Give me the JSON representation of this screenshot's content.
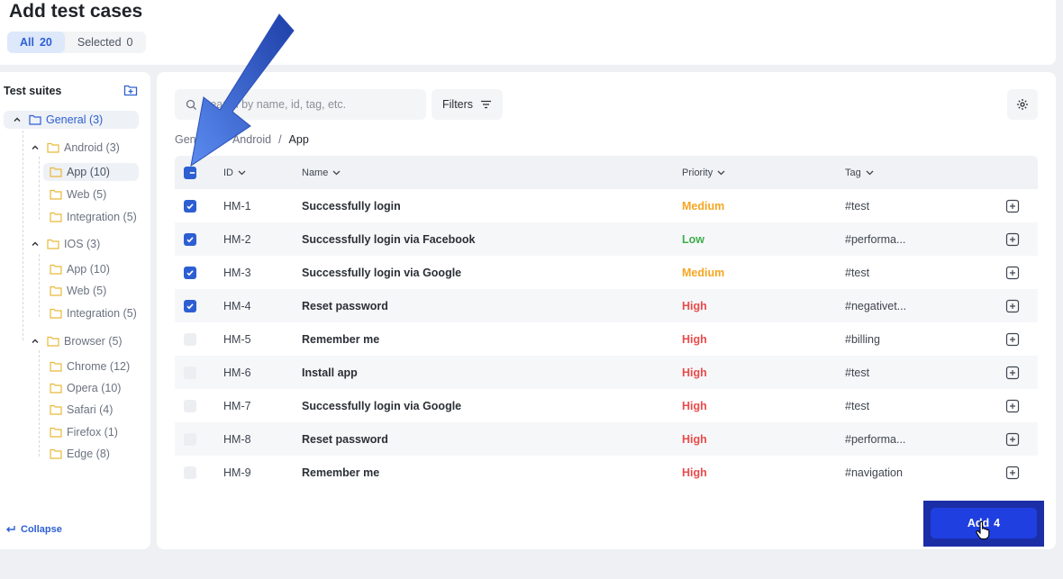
{
  "header": {
    "title": "Add test cases",
    "tabs": [
      {
        "label": "All",
        "count": "20"
      },
      {
        "label": "Selected",
        "count": "0"
      }
    ]
  },
  "sidebar": {
    "title": "Test suites",
    "collapse_label": "Collapse",
    "tree": [
      {
        "label": "General (3)"
      },
      {
        "label": "Android (3)"
      },
      {
        "label": "App (10)"
      },
      {
        "label": "Web (5)"
      },
      {
        "label": "Integration (5)"
      },
      {
        "label": "IOS (3)"
      },
      {
        "label": "App (10)"
      },
      {
        "label": "Web (5)"
      },
      {
        "label": "Integration (5)"
      },
      {
        "label": "Browser (5)"
      },
      {
        "label": "Chrome (12)"
      },
      {
        "label": "Opera (10)"
      },
      {
        "label": "Safari (4)"
      },
      {
        "label": "Firefox (1)"
      },
      {
        "label": "Edge (8)"
      }
    ]
  },
  "toolbar": {
    "search_placeholder": "Search by name, id, tag, etc.",
    "filters_label": "Filters"
  },
  "breadcrumb": [
    "General",
    "Android",
    "App"
  ],
  "table": {
    "columns": {
      "id": "ID",
      "name": "Name",
      "priority": "Priority",
      "tag": "Tag"
    },
    "rows": [
      {
        "id": "HM-1",
        "name": "Successfully login",
        "priority": "Medium",
        "tag": "#test",
        "checked": true
      },
      {
        "id": "HM-2",
        "name": "Successfully login via Facebook",
        "priority": "Low",
        "tag": "#performa...",
        "checked": true
      },
      {
        "id": "HM-3",
        "name": "Successfully login via Google",
        "priority": "Medium",
        "tag": "#test",
        "checked": true
      },
      {
        "id": "HM-4",
        "name": "Reset password",
        "priority": "High",
        "tag": "#negativet...",
        "checked": true
      },
      {
        "id": "HM-5",
        "name": "Remember me",
        "priority": "High",
        "tag": "#billing",
        "checked": false
      },
      {
        "id": "HM-6",
        "name": "Install app",
        "priority": "High",
        "tag": "#test",
        "checked": false
      },
      {
        "id": "HM-7",
        "name": "Successfully login via Google",
        "priority": "High",
        "tag": "#test",
        "checked": false
      },
      {
        "id": "HM-8",
        "name": "Reset password",
        "priority": "High",
        "tag": "#performa...",
        "checked": false
      },
      {
        "id": "HM-9",
        "name": "Remember me",
        "priority": "High",
        "tag": "#navigation",
        "checked": false
      }
    ]
  },
  "priority_colors": {
    "Medium": "#f5a623",
    "Low": "#3fae4a",
    "High": "#ea4b4b"
  },
  "accent_color": "#2d5fd3",
  "add_button": {
    "label": "Add",
    "count": "4"
  },
  "icons": [
    "search-icon",
    "filter-icon",
    "gear-icon",
    "folder-icon",
    "folder-plus-icon",
    "chevron-up-icon",
    "chevron-down-icon",
    "plus-square-icon",
    "collapse-arrow-icon",
    "hand-cursor-icon",
    "pointer-arrow-annotation"
  ]
}
